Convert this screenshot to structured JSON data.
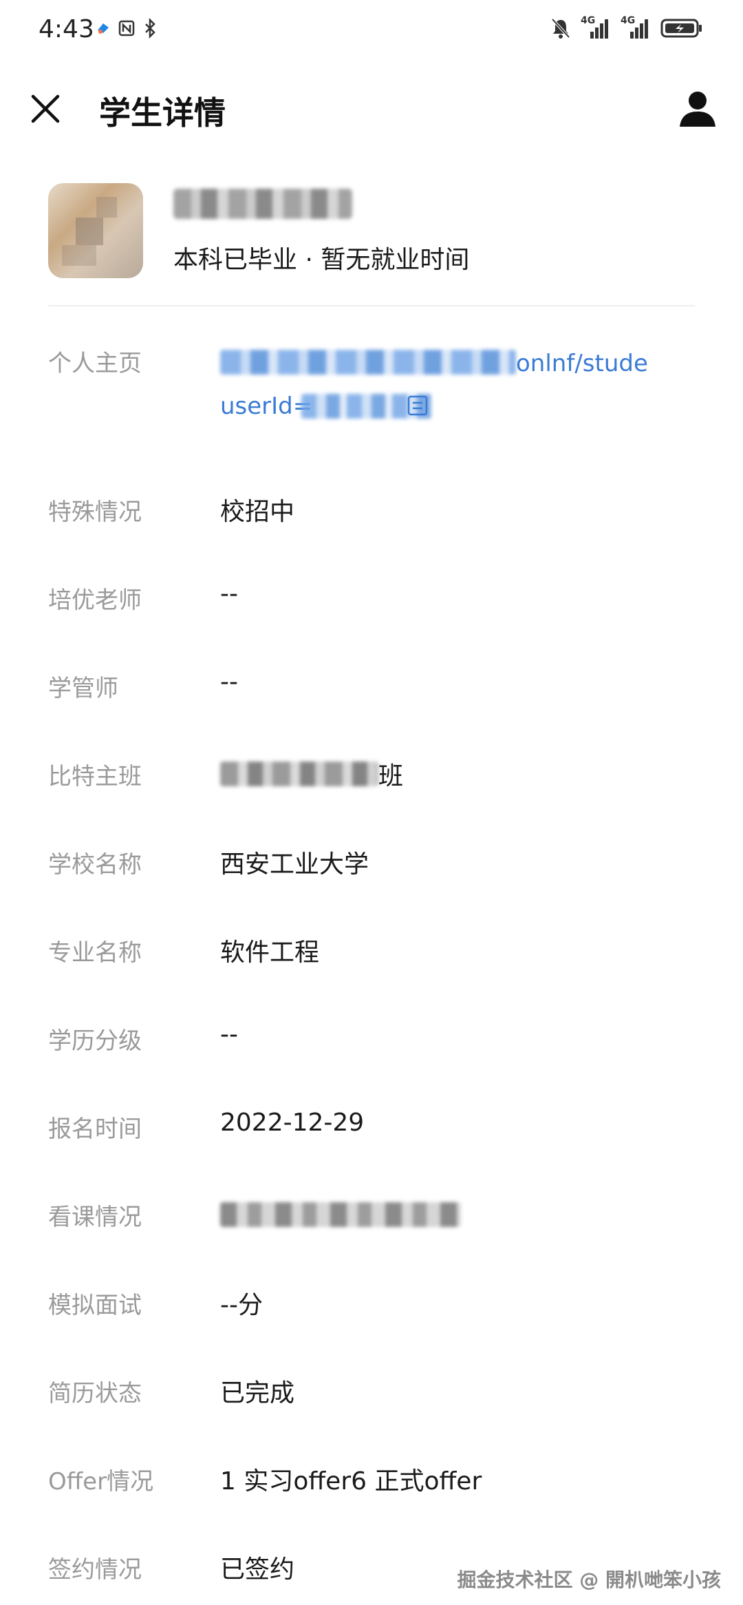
{
  "status_bar": {
    "time": "4:43",
    "left_icons": [
      "app-notification-icon",
      "nfc-icon",
      "bluetooth-icon"
    ],
    "right_icons": [
      "mute-icon",
      "signal-4g-icon",
      "signal-4g-icon",
      "battery-charging-icon"
    ],
    "network_labels": [
      "4G",
      "4G"
    ]
  },
  "header": {
    "title": "学生详情",
    "close_icon": "close-icon",
    "profile_icon": "person-icon"
  },
  "student": {
    "education_status": "本科已毕业 · 暂无就业时间"
  },
  "details": {
    "homepage": {
      "label": "个人主页",
      "link_line1_visible": "onlnf/stude",
      "link_line2_visible": "userId="
    },
    "special": {
      "label": "特殊情况",
      "value": "校招中"
    },
    "teacher": {
      "label": "培优老师",
      "value": "--"
    },
    "manager": {
      "label": "学管师",
      "value": "--"
    },
    "class": {
      "label": "比特主班",
      "value_visible_tail": "班"
    },
    "school": {
      "label": "学校名称",
      "value": "西安工业大学"
    },
    "major": {
      "label": "专业名称",
      "value": "软件工程"
    },
    "degree_level": {
      "label": "学历分级",
      "value": "--"
    },
    "enroll_time": {
      "label": "报名时间",
      "value": "2022-12-29"
    },
    "watch_status": {
      "label": "看课情况"
    },
    "mock_interview": {
      "label": "模拟面试",
      "value": "--分"
    },
    "resume_status": {
      "label": "简历状态",
      "value": "已完成"
    },
    "offer": {
      "label": "Offer情况",
      "value": "1 实习offer6 正式offer"
    },
    "contract": {
      "label": "签约情况",
      "value": "已签约"
    }
  },
  "watermark": "掘金技术社区 @ 開朳哋笨小孩",
  "colors": {
    "label": "#9a9a9a",
    "value": "#1a1a1a",
    "link": "#3a7bd5",
    "divider": "#eeeeee",
    "background": "#ffffff"
  }
}
